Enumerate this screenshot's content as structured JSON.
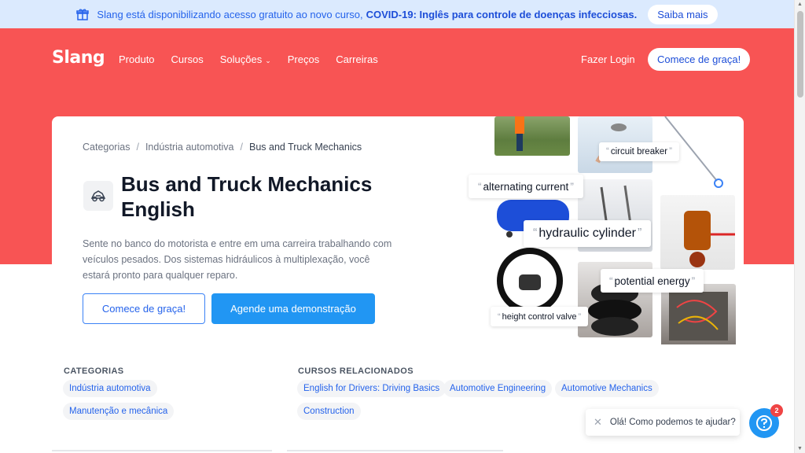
{
  "announcement": {
    "text": "Slang está disponibilizando acesso gratuito ao novo curso,",
    "bold": "COVID-19: Inglês para controle de doenças infecciosas.",
    "button": "Saiba mais"
  },
  "nav": {
    "logo": "Slang",
    "links": [
      "Produto",
      "Cursos",
      "Soluções",
      "Preços",
      "Carreiras"
    ],
    "login": "Fazer Login",
    "cta": "Comece de graça!"
  },
  "breadcrumb": [
    "Categorias",
    "Indústria automotiva",
    "Bus and Truck Mechanics"
  ],
  "hero": {
    "title": "Bus and Truck Mechanics English",
    "description": "Sente no banco do motorista e entre em uma carreira trabalhando com veículos pesados. Dos sistemas hidráulicos à multiplexação, você estará pronto para qualquer reparo.",
    "btn_primary": "Comece de graça!",
    "btn_secondary": "Agende uma demonstração"
  },
  "collage_tags": {
    "t1": "circuit breaker",
    "t2": "alternating current",
    "t3": "hydraulic cylinder",
    "t4": "potential energy",
    "t5": "height control valve"
  },
  "categories": {
    "label": "CATEGORIAS",
    "items": [
      "Indústria automotiva",
      "Manutenção e mecânica"
    ]
  },
  "related": {
    "label": "CURSOS RELACIONADOS",
    "items": [
      "English for Drivers: Driving Basics",
      "Automotive Engineering",
      "Automotive Mechanics",
      "Construction"
    ]
  },
  "chat": {
    "message": "Olá! Como podemos te ajudar?",
    "badge": "2"
  },
  "colors": {
    "brand_red": "#f85454",
    "accent_blue": "#2196f3",
    "banner_blue": "#dbeafe"
  }
}
